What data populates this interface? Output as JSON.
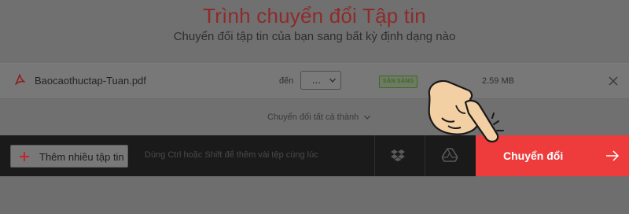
{
  "header": {
    "title": "Trình chuyển đổi Tập tin",
    "subtitle": "Chuyển đổi tập tin của bạn sang bất kỳ định dạng nào"
  },
  "file": {
    "name": "Baocaothuctap-Tuan.pdf",
    "icon": "pdf-icon",
    "to_label": "đến",
    "format_value": "...",
    "status": "SẴN SÀNG",
    "size": "2.59 MB"
  },
  "convert_all": {
    "label": "Chuyển đổi tất cả thành"
  },
  "toolbar": {
    "add_files_label": "Thêm nhiều tập tin",
    "hint": "Dùng Ctrl hoặc Shift để thêm vài tệp cùng lúc",
    "convert_label": "Chuyển đổi"
  },
  "colors": {
    "accent": "#ee3b3b",
    "title": "#8f2a2a",
    "status": "#3a6a1e",
    "bar": "#1a1a1a"
  }
}
